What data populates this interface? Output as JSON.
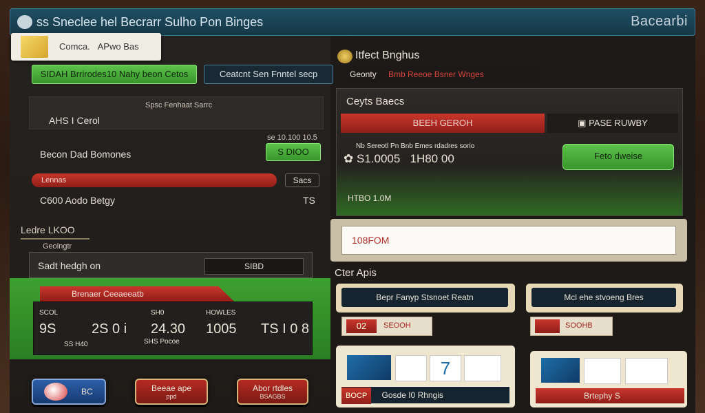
{
  "titlebar": {
    "title": "ss Sneclee hel Becrarr Sulho Pon Binges",
    "brand": "Bacearbi"
  },
  "user": {
    "label": "Comca.",
    "value": "APwo Bas"
  },
  "left": {
    "green_tab": "SIDAH Brrirodes10 Nahy beon Cetos",
    "dark_tab": "Ceatcnt Sen Fnntel secp",
    "stats_header": "Spsc Fenhaat Sarrc",
    "stats_label": "AHS I Cerol",
    "small_line": "se 10.100 10.5",
    "row1_label": "Becon Dad Bomones",
    "row1_button": "S DIOO",
    "row2_bar": "Lennas",
    "row2_value": "Sacs",
    "row3_label": "C600 Aodo Betgy",
    "row3_value": "TS",
    "section": "Ledre  LKOO",
    "section_sub": "Geolngtr",
    "input_label": "Sadt hedgh on",
    "input_value": "SIBD",
    "redtab": "Brenaer Ceeaeeatb",
    "scores": [
      {
        "label": "SCOL",
        "value": "9S",
        "sub": ""
      },
      {
        "label": "",
        "value": "2S 0 i",
        "sub": "SS H40"
      },
      {
        "label": "SH0",
        "value": "24.30",
        "sub": "SHS Pocoe"
      },
      {
        "label": "HOWLES",
        "value": "1005",
        "sub": ""
      },
      {
        "label": "",
        "value": "TS I 0 8",
        "sub": ""
      }
    ],
    "buttons": [
      {
        "label": "BC"
      },
      {
        "label": "Beeae ape",
        "sub": "ppd"
      },
      {
        "label": "Abor rtdles",
        "sub": "BSAGBS"
      }
    ]
  },
  "right": {
    "title": "Itfect Bnghus",
    "subtitle": "Geonty",
    "subtitle_red": "Bmb Reeoe Bsner Wnges",
    "panel_title": "Ceyts Baecs",
    "red_bar": "BEEH GEROH",
    "page_history": "PASE RUWBY",
    "stat_line": "Nb Sereotl Pn Bnb Emes rdadres sorio",
    "amount": "S1.0005",
    "amount2": "1H80 00",
    "green_button": "Feto dweise",
    "green_line": "HTBO 1.0M",
    "input_value": "108FOM",
    "section": "Cter Apis",
    "card1_title": "Bepr Fanyp Stsnoet Reatn",
    "card2_title": "Mcl ehe stvoeng Bres",
    "tag1_num": "02",
    "tag1_text": "SEOOH",
    "tag2_text": "SOOHB",
    "card1_bottom": "Gosde I0 Rhngis",
    "card1_bottom_tag": "BOCP",
    "card2_bottom": "Brtephy S"
  }
}
